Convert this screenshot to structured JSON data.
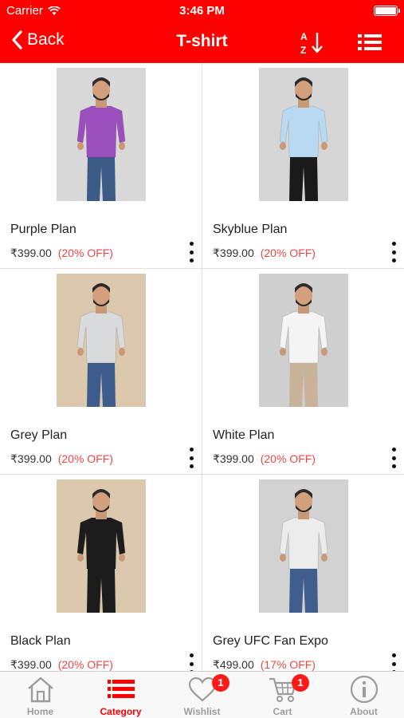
{
  "status_bar": {
    "carrier": "Carrier",
    "time": "3:46 PM"
  },
  "nav": {
    "back_label": "Back",
    "title": "T-shirt",
    "sort_icon": "sort-a-z-icon",
    "list_icon": "list-view-icon"
  },
  "products": [
    {
      "name": "Purple Plan",
      "price": "₹399.00",
      "discount": "(20% OFF)",
      "shirt_color": "#9b4fbf",
      "pants_color": "#3b5a86",
      "bg_color": "#d8d8d8"
    },
    {
      "name": "Skyblue Plan",
      "price": "₹399.00",
      "discount": "(20% OFF)",
      "shirt_color": "#b9d8f2",
      "pants_color": "#1a1a1a",
      "bg_color": "#d6d6d6"
    },
    {
      "name": "Grey Plan",
      "price": "₹399.00",
      "discount": "(20% OFF)",
      "shirt_color": "#d8dadb",
      "pants_color": "#3e5d8c",
      "bg_color": "#dcc9ad"
    },
    {
      "name": "White Plan",
      "price": "₹399.00",
      "discount": "(20% OFF)",
      "shirt_color": "#f4f4f4",
      "pants_color": "#c9b29a",
      "bg_color": "#cfcfcf"
    },
    {
      "name": "Black Plan",
      "price": "₹399.00",
      "discount": "(20% OFF)",
      "shirt_color": "#1c1c1c",
      "pants_color": "#1c1c1c",
      "bg_color": "#dcc9ad"
    },
    {
      "name": "Grey UFC Fan Expo",
      "price": "₹499.00",
      "discount": "(17% OFF)",
      "shirt_color": "#ececec",
      "pants_color": "#3f5e8e",
      "bg_color": "#d2d2d2"
    }
  ],
  "tabbar": {
    "tabs": [
      {
        "label": "Home",
        "icon": "home-icon"
      },
      {
        "label": "Category",
        "icon": "category-list-icon"
      },
      {
        "label": "Wishlist",
        "icon": "heart-icon",
        "badge": "1"
      },
      {
        "label": "Cart",
        "icon": "cart-icon",
        "badge": "1"
      },
      {
        "label": "About",
        "icon": "info-icon"
      }
    ],
    "active_index": 1
  },
  "colors": {
    "brand_red": "#ff0000",
    "discount_red": "#f04545",
    "inactive_grey": "#9c9c9c"
  }
}
